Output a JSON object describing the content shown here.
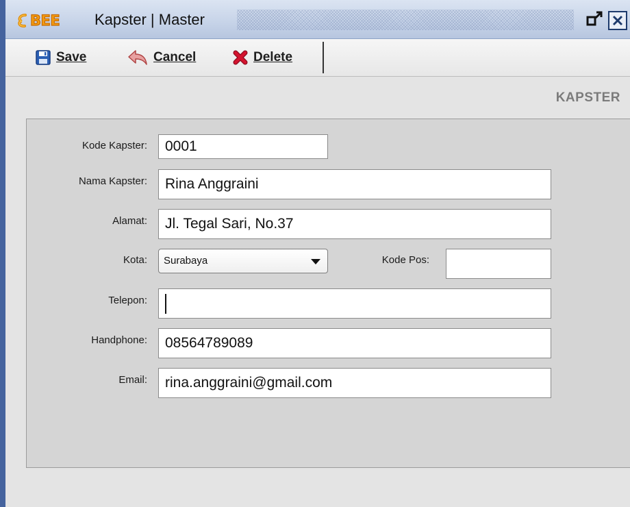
{
  "window": {
    "logo_text": "BEE",
    "title": "Kapster | Master"
  },
  "toolbar": {
    "save_label": "Save",
    "cancel_label": "Cancel",
    "delete_label": "Delete"
  },
  "section": {
    "title": "KAPSTER"
  },
  "form": {
    "kode_kapster": {
      "label": "Kode Kapster:",
      "value": "0001"
    },
    "nama_kapster": {
      "label": "Nama Kapster:",
      "value": "Rina Anggraini"
    },
    "alamat": {
      "label": "Alamat:",
      "value": "Jl. Tegal Sari, No.37"
    },
    "kota": {
      "label": "Kota:",
      "value": "Surabaya"
    },
    "kode_pos": {
      "label": "Kode Pos:",
      "value": ""
    },
    "telepon": {
      "label": "Telepon:",
      "value": ""
    },
    "handphone": {
      "label": "Handphone:",
      "value": "08564789089"
    },
    "email": {
      "label": "Email:",
      "value": "rina.anggraini@gmail.com"
    }
  },
  "colors": {
    "window_border": "#45639e",
    "title_bar": "#c6d3e8",
    "panel_background": "#d5d5d5",
    "logo_orange": "#f39b12",
    "delete_red": "#c8102e",
    "save_blue": "#2b5fb4"
  },
  "icons": {
    "save": "floppy-disk-icon",
    "cancel": "undo-arrow-icon",
    "delete": "red-x-icon",
    "restore": "restore-window-icon",
    "close": "close-window-icon"
  }
}
